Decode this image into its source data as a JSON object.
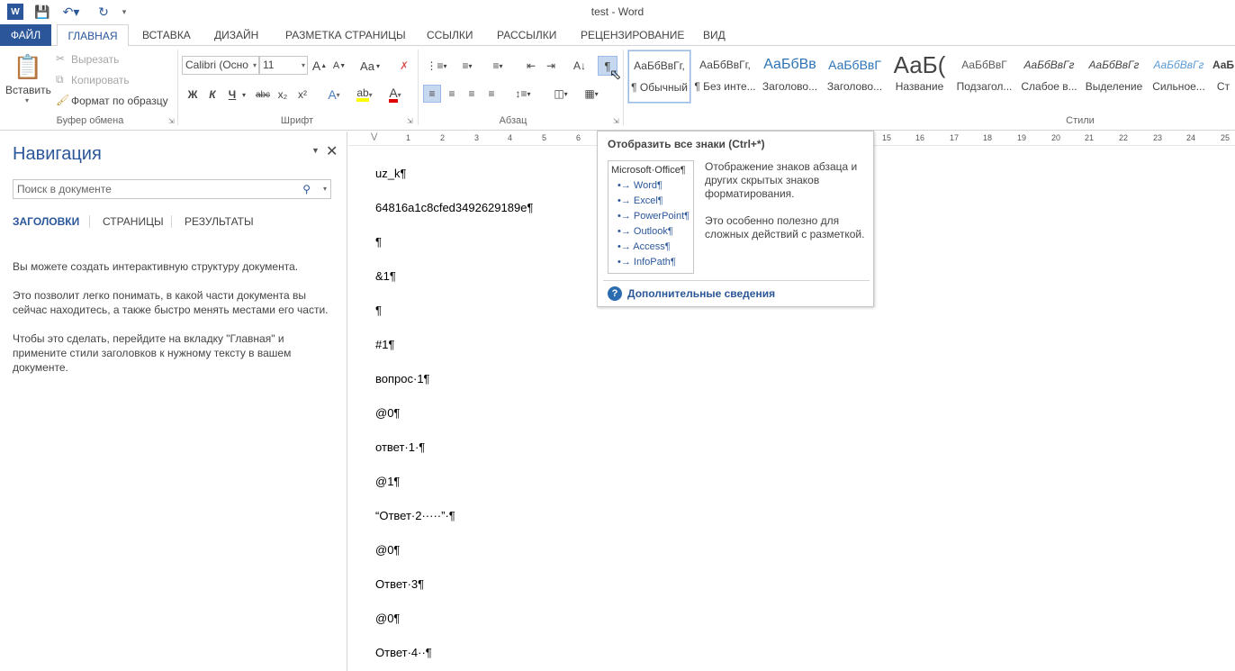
{
  "window": {
    "title": "test - Word"
  },
  "tabs": [
    "ФАЙЛ",
    "ГЛАВНАЯ",
    "ВСТАВКА",
    "ДИЗАЙН",
    "РАЗМЕТКА СТРАНИЦЫ",
    "ССЫЛКИ",
    "РАССЫЛКИ",
    "РЕЦЕНЗИРОВАНИЕ",
    "ВИД"
  ],
  "clipboard": {
    "paste": "Вставить",
    "cut": "Вырезать",
    "copy": "Копировать",
    "format_painter": "Формат по образцу",
    "label": "Буфер обмена"
  },
  "font": {
    "name": "Calibri (Осно",
    "size": "11",
    "label": "Шрифт",
    "bold": "Ж",
    "italic": "К",
    "underline": "Ч",
    "strike": "abc",
    "sub": "x₂",
    "sup": "x²",
    "grow": "A",
    "shrink": "A",
    "case": "Aa"
  },
  "paragraph": {
    "label": "Абзац",
    "pilcrow": "¶"
  },
  "styles": {
    "label": "Стили",
    "items": [
      {
        "sample": "АаБбВвГг,",
        "name": "¶ Обычный",
        "color": "#000000"
      },
      {
        "sample": "АаБбВвГг,",
        "name": "¶ Без инте...",
        "color": "#000000"
      },
      {
        "sample": "АаБбВв",
        "name": "Заголово...",
        "color": "#2e74b5"
      },
      {
        "sample": "АаБбВвГ",
        "name": "Заголово...",
        "color": "#2e74b5"
      },
      {
        "sample": "АаБ(",
        "name": "Название",
        "color": "#000000"
      },
      {
        "sample": "АаБбВвГ",
        "name": "Подзагол...",
        "color": "#595959"
      },
      {
        "sample": "АаБбВвГг",
        "name": "Слабое в...",
        "color": "#404040"
      },
      {
        "sample": "АаБбВвГг",
        "name": "Выделение",
        "color": "#000000"
      },
      {
        "sample": "АаБбВвГг",
        "name": "Сильное...",
        "color": "#5b9bd5"
      },
      {
        "sample": "АаБ",
        "name": "Ст",
        "color": "#000000"
      }
    ]
  },
  "nav": {
    "title": "Навигация",
    "search_placeholder": "Поиск в документе",
    "tabs": [
      "ЗАГОЛОВКИ",
      "СТРАНИЦЫ",
      "РЕЗУЛЬТАТЫ"
    ],
    "p1": "Вы можете создать интерактивную структуру документа.",
    "p2": "Это позволит легко понимать, в какой части документа вы сейчас находитесь, а также быстро менять местами его части.",
    "p3": "Чтобы это сделать, перейдите на вкладку \"Главная\" и примените стили заголовков к нужному тексту в вашем документе."
  },
  "ruler": [
    "1",
    "2",
    "3",
    "4",
    "5",
    "6",
    "15",
    "16",
    "17",
    "18",
    "19",
    "20",
    "21",
    "22",
    "23",
    "24",
    "25"
  ],
  "document": {
    "lines": [
      "uz_k¶",
      "64816a1c8cfed3492629189e¶",
      "¶",
      "&1¶",
      "¶",
      "#1¶",
      "вопрос·1¶",
      "@0¶",
      "ответ·1·¶",
      "@1¶",
      "“Ответ·2·····”·¶",
      "@0¶",
      "Ответ·3¶",
      "@0¶",
      "Ответ·4··¶"
    ]
  },
  "tooltip": {
    "title": "Отобразить все знаки (Ctrl+*)",
    "box": [
      "Microsoft·Office¶",
      "•→ Word¶",
      "•→ Excel¶",
      "•→ PowerPoint¶",
      "•→ Outlook¶",
      "•→ Access¶",
      "•→ InfoPath¶"
    ],
    "desc1": "Отображение знаков абзаца и других скрытых знаков форматирования.",
    "desc2": "Это особенно полезно для сложных действий с разметкой.",
    "more": "Дополнительные сведения"
  },
  "colors": {
    "accent": "#2b579a"
  }
}
